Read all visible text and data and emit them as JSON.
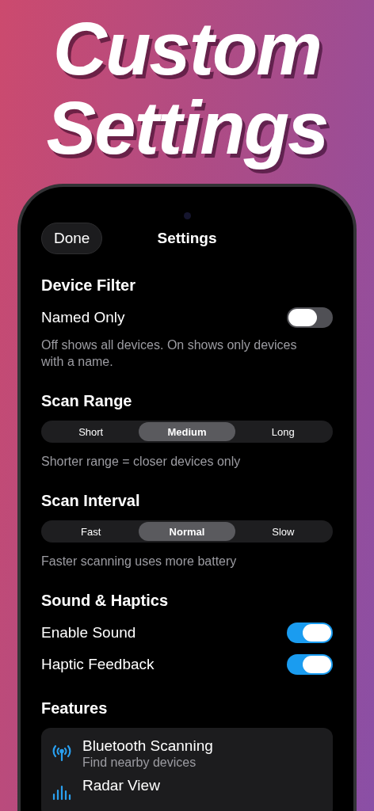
{
  "headline": [
    "Custom",
    "Settings"
  ],
  "nav": {
    "done": "Done",
    "title": "Settings"
  },
  "sections": [
    {
      "kind": "toggles",
      "title": "Device Filter",
      "rows": [
        {
          "label": "Named Only",
          "on": false
        }
      ],
      "note": "Off shows all devices. On shows only devices with a name."
    },
    {
      "kind": "segmented",
      "title": "Scan Range",
      "options": [
        {
          "label": "Short",
          "selected": false
        },
        {
          "label": "Medium",
          "selected": true
        },
        {
          "label": "Long",
          "selected": false
        }
      ],
      "note": "Shorter range = closer devices only"
    },
    {
      "kind": "segmented",
      "title": "Scan Interval",
      "options": [
        {
          "label": "Fast",
          "selected": false
        },
        {
          "label": "Normal",
          "selected": true
        },
        {
          "label": "Slow",
          "selected": false
        }
      ],
      "note": "Faster scanning uses more battery"
    },
    {
      "kind": "toggles",
      "title": "Sound & Haptics",
      "rows": [
        {
          "label": "Enable Sound",
          "on": true
        },
        {
          "label": "Haptic Feedback",
          "on": true
        }
      ]
    },
    {
      "kind": "features",
      "title": "Features",
      "items": [
        {
          "kind": "antenna",
          "title": "Bluetooth Scanning",
          "subtitle": "Find nearby devices"
        },
        {
          "kind": "bars",
          "title": "Radar View"
        }
      ]
    }
  ]
}
